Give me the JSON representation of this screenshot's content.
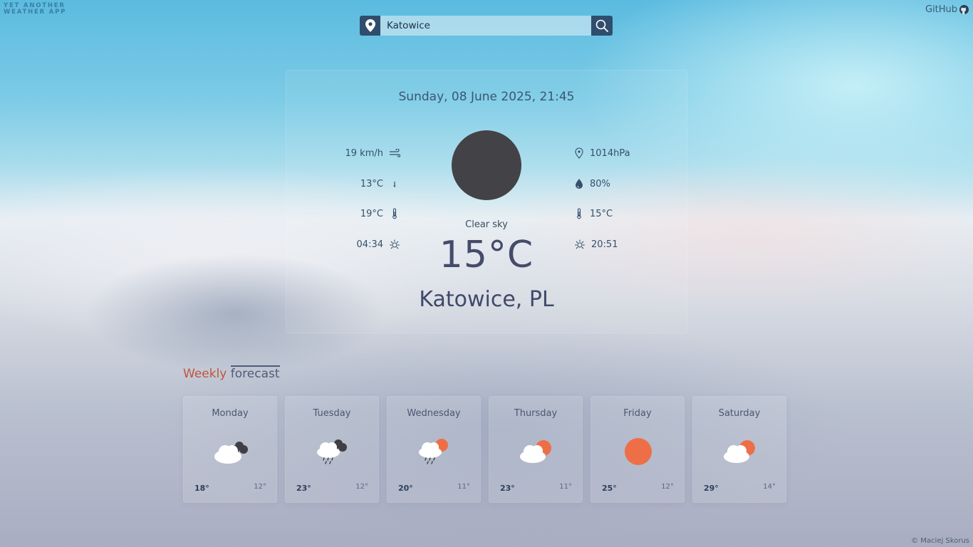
{
  "brand": {
    "line1": "YET ANOTHER",
    "line2": "WEATHER APP"
  },
  "github": {
    "label": "GitHub",
    "icon": "github-icon"
  },
  "search": {
    "value": "Katowice",
    "pin_icon": "map-pin-icon",
    "search_icon": "magnifier-icon"
  },
  "current": {
    "datetime": "Sunday, 08 June 2025, 21:45",
    "condition": "Clear sky",
    "temperature": "15°C",
    "city": "Katowice, PL",
    "icon": "clear-night-moon-icon",
    "left_stats": [
      {
        "value": "19 km/h",
        "icon": "wind-icon"
      },
      {
        "value": "13°C",
        "icon": "arrow-down-icon"
      },
      {
        "value": "19°C",
        "icon": "thermometer-icon"
      },
      {
        "value": "04:34",
        "icon": "sunrise-icon"
      }
    ],
    "right_stats": [
      {
        "value": "1014hPa",
        "icon": "pressure-gauge-icon"
      },
      {
        "value": "80%",
        "icon": "humidity-drop-icon"
      },
      {
        "value": "15°C",
        "icon": "thermometer-icon"
      },
      {
        "value": "20:51",
        "icon": "sunset-icon"
      }
    ]
  },
  "weekly": {
    "title_part1": "Weekly",
    "title_part2": "forecast",
    "days": [
      {
        "name": "Monday",
        "hi": "18°",
        "lo": "12°",
        "icon": "cloud-dark-icon"
      },
      {
        "name": "Tuesday",
        "hi": "23°",
        "lo": "12°",
        "icon": "cloud-rain-icon"
      },
      {
        "name": "Wednesday",
        "hi": "20°",
        "lo": "11°",
        "icon": "cloud-sun-rain-icon"
      },
      {
        "name": "Thursday",
        "hi": "23°",
        "lo": "11°",
        "icon": "cloud-sun-icon"
      },
      {
        "name": "Friday",
        "hi": "25°",
        "lo": "12°",
        "icon": "sun-icon"
      },
      {
        "name": "Saturday",
        "hi": "29°",
        "lo": "14°",
        "icon": "cloud-sun-icon"
      }
    ]
  },
  "footer": {
    "text": "© Maciej Skorus"
  },
  "colors": {
    "accent": "#c0553c",
    "sun": "#ee6f47",
    "navy": "#2f4d6d",
    "moon": "#434246"
  }
}
